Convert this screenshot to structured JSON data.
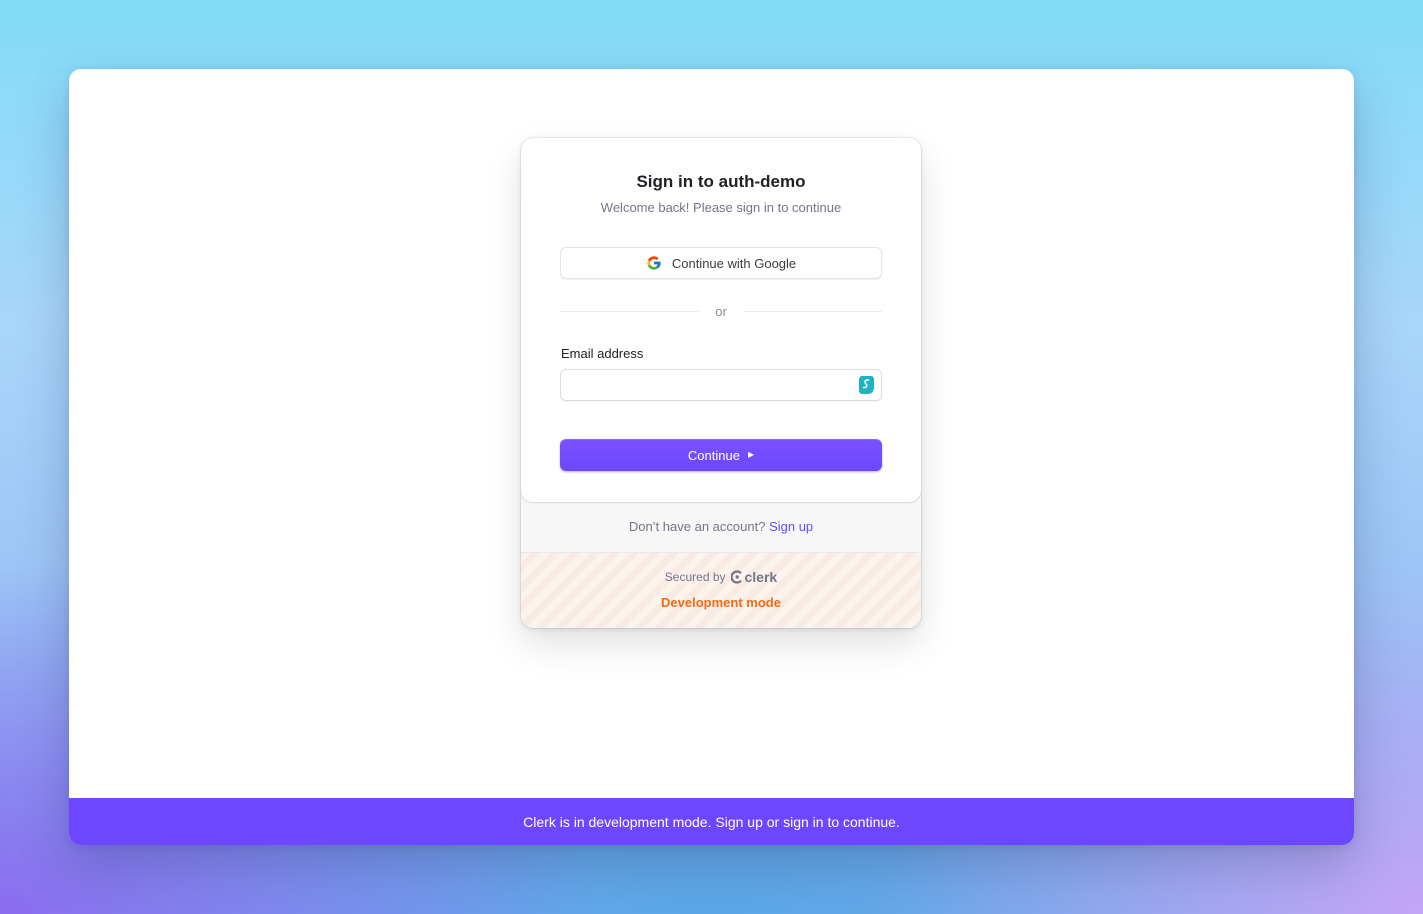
{
  "signin": {
    "title": "Sign in to auth-demo",
    "subtitle": "Welcome back! Please sign in to continue",
    "google_button": "Continue with Google",
    "divider": "or",
    "email_label": "Email address",
    "email_value": "",
    "continue_button": "Continue"
  },
  "footer": {
    "no_account_text": "Don’t have an account?",
    "signup_link": "Sign up",
    "secured_by": "Secured by",
    "clerk_brand": "clerk",
    "dev_mode": "Development mode"
  },
  "banner": {
    "text": "Clerk is in development mode. Sign up or sign in to continue."
  },
  "icons": {
    "google": "google-icon",
    "password_manager": "surfshark-icon",
    "arrow": "play-arrow-icon",
    "clerk": "clerk-logo-icon"
  },
  "colors": {
    "accent": "#6c47ff",
    "dev_mode": "#f36b16",
    "title": "#212126",
    "muted": "#747686"
  }
}
